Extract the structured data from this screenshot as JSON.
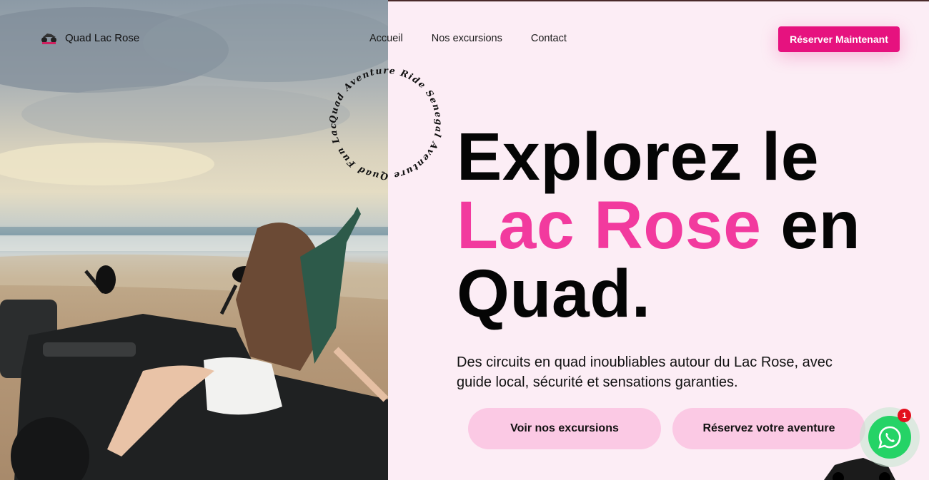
{
  "brand": {
    "name": "Quad Lac Rose",
    "logo_icon": "quad-logo-icon"
  },
  "nav": {
    "items": [
      "Accueil",
      "Nos excursions",
      "Contact"
    ]
  },
  "header": {
    "cta_label": "Réserver Maintenant"
  },
  "circle_text": "Quad Aventure Ride Senegal Aventure Quad Fun Lac Rose",
  "hero": {
    "headline_line1": "Explorez le",
    "headline_pink": "Lac Rose",
    "headline_after_pink": " en",
    "headline_line3": "Quad.",
    "subtitle": "Des circuits en quad inoubliables autour du Lac Rose, avec guide local, sécurité et sensations garanties.",
    "btn_excursions": "Voir nos excursions",
    "btn_reserve": "Réservez votre aventure"
  },
  "whatsapp": {
    "icon": "whatsapp-icon",
    "badge_count": "1"
  },
  "colors": {
    "accent": "#e6127f",
    "pink_text": "#f23a9e",
    "pill_bg": "#fbc9e4",
    "page_bg": "#fcedf5",
    "whatsapp": "#25d366"
  }
}
